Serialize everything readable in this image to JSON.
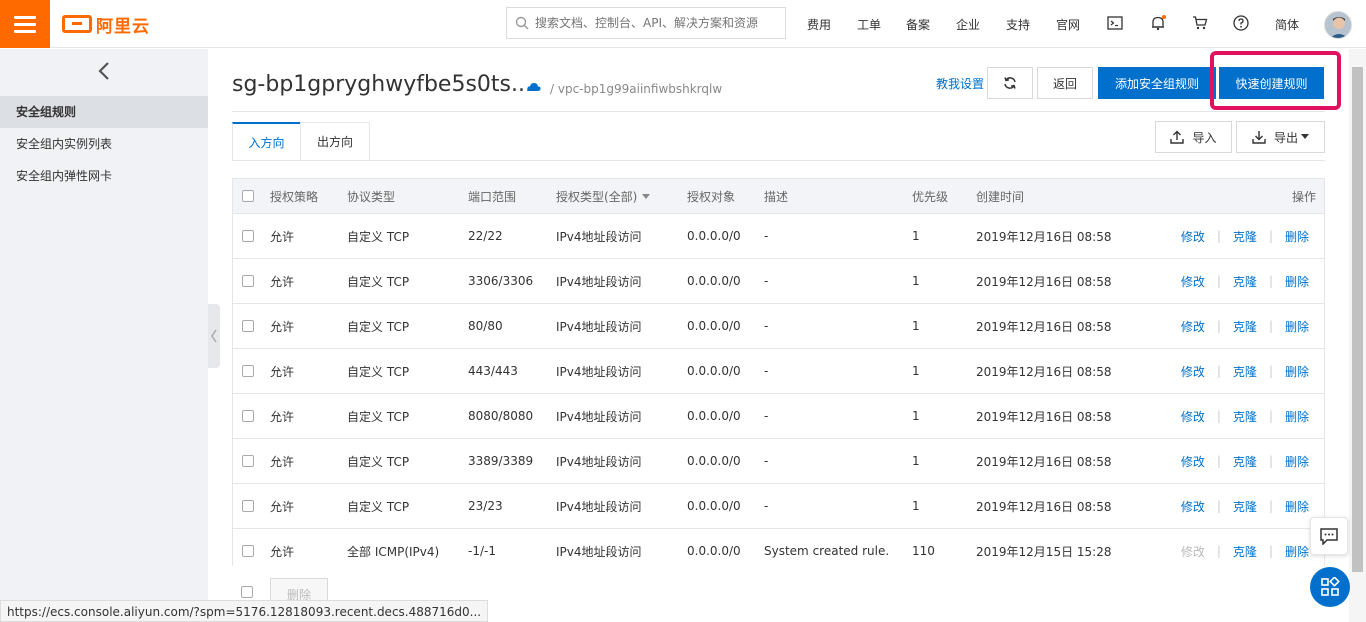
{
  "topbar": {
    "logo_text": "阿里云",
    "search_placeholder": "搜索文档、控制台、API、解决方案和资源",
    "nav": [
      "费用",
      "工单",
      "备案",
      "企业",
      "支持",
      "官网"
    ],
    "lang": "简体",
    "accent": "#ff6a00"
  },
  "sidebar": {
    "items": [
      "安全组规则",
      "安全组内实例列表",
      "安全组内弹性网卡"
    ],
    "active_index": 0
  },
  "header": {
    "title": "sg-bp1gpryghwyfbe5s0ts...",
    "vpc": "/ vpc-bp1g99aiinfiwbshkrqlw",
    "help": "教我设置",
    "back": "返回",
    "add_rule": "添加安全组规则",
    "quick_rule": "快速创建规则",
    "primary_color": "#0070cc"
  },
  "tabs": [
    "入方向",
    "出方向"
  ],
  "toolbar": {
    "import": "导入",
    "export": "导出"
  },
  "table": {
    "columns": [
      "授权策略",
      "协议类型",
      "端口范围",
      "授权类型(全部)",
      "授权对象",
      "描述",
      "优先级",
      "创建时间",
      "操作"
    ],
    "actions": [
      "修改",
      "克隆",
      "删除"
    ],
    "rows": [
      {
        "policy": "允许",
        "protocol": "自定义 TCP",
        "port": "22/22",
        "auth_type": "IPv4地址段访问",
        "object": "0.0.0.0/0",
        "desc": "-",
        "priority": "1",
        "time": "2019年12月16日 08:58"
      },
      {
        "policy": "允许",
        "protocol": "自定义 TCP",
        "port": "3306/3306",
        "auth_type": "IPv4地址段访问",
        "object": "0.0.0.0/0",
        "desc": "-",
        "priority": "1",
        "time": "2019年12月16日 08:58"
      },
      {
        "policy": "允许",
        "protocol": "自定义 TCP",
        "port": "80/80",
        "auth_type": "IPv4地址段访问",
        "object": "0.0.0.0/0",
        "desc": "-",
        "priority": "1",
        "time": "2019年12月16日 08:58"
      },
      {
        "policy": "允许",
        "protocol": "自定义 TCP",
        "port": "443/443",
        "auth_type": "IPv4地址段访问",
        "object": "0.0.0.0/0",
        "desc": "-",
        "priority": "1",
        "time": "2019年12月16日 08:58"
      },
      {
        "policy": "允许",
        "protocol": "自定义 TCP",
        "port": "8080/8080",
        "auth_type": "IPv4地址段访问",
        "object": "0.0.0.0/0",
        "desc": "-",
        "priority": "1",
        "time": "2019年12月16日 08:58"
      },
      {
        "policy": "允许",
        "protocol": "自定义 TCP",
        "port": "3389/3389",
        "auth_type": "IPv4地址段访问",
        "object": "0.0.0.0/0",
        "desc": "-",
        "priority": "1",
        "time": "2019年12月16日 08:58"
      },
      {
        "policy": "允许",
        "protocol": "自定义 TCP",
        "port": "23/23",
        "auth_type": "IPv4地址段访问",
        "object": "0.0.0.0/0",
        "desc": "-",
        "priority": "1",
        "time": "2019年12月16日 08:58"
      },
      {
        "policy": "允许",
        "protocol": "全部 ICMP(IPv4)",
        "port": "-1/-1",
        "auth_type": "IPv4地址段访问",
        "object": "0.0.0.0/0",
        "desc": "System created rule.",
        "priority": "110",
        "time": "2019年12月15日 15:28",
        "edit_disabled": true
      }
    ],
    "batch_delete": "删除"
  },
  "status_url": "https://ecs.console.aliyun.com/?spm=5176.12818093.recent.decs.488716d0..."
}
